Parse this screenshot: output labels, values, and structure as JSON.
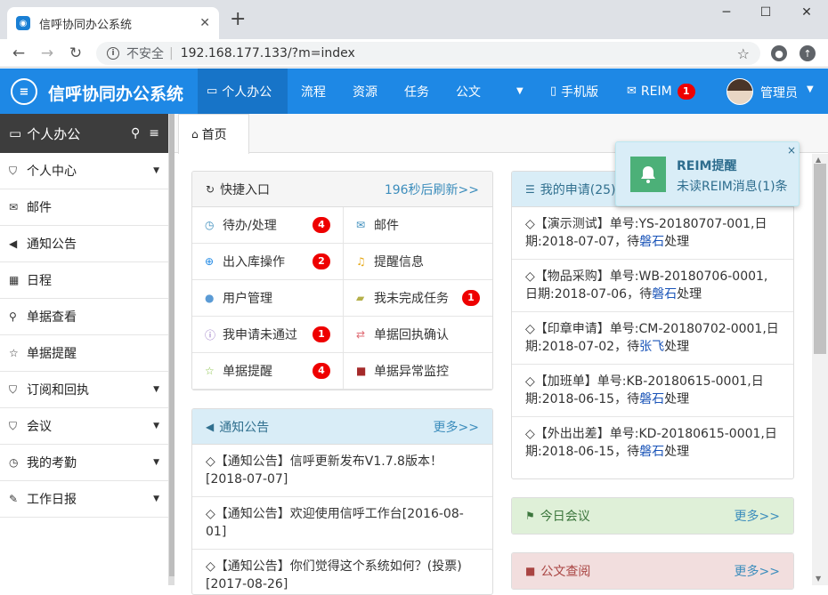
{
  "browser": {
    "tab_title": "信呼协同办公系统",
    "tab_close": "✕",
    "new_tab": "+",
    "insecure_label": "不安全",
    "url": "192.168.177.133/?m=index"
  },
  "nav": {
    "brand": "信呼协同办公系统",
    "items": [
      {
        "label": "个人办公",
        "active": true
      },
      {
        "label": "流程"
      },
      {
        "label": "资源"
      },
      {
        "label": "任务"
      },
      {
        "label": "公文"
      }
    ],
    "mobile": "手机版",
    "reim": "REIM",
    "reim_count": "1",
    "user": "管理员"
  },
  "sidebar": {
    "title": "个人办公",
    "items": [
      {
        "label": "个人中心",
        "icon": "bookmark-icon",
        "expandable": true
      },
      {
        "label": "邮件",
        "icon": "envelope-icon"
      },
      {
        "label": "通知公告",
        "icon": "volume-icon"
      },
      {
        "label": "日程",
        "icon": "calendar-icon"
      },
      {
        "label": "单据查看",
        "icon": "search-icon"
      },
      {
        "label": "单据提醒",
        "icon": "star-icon"
      },
      {
        "label": "订阅和回执",
        "icon": "bookmark-icon",
        "expandable": true
      },
      {
        "label": "会议",
        "icon": "bookmark-icon",
        "expandable": true
      },
      {
        "label": "我的考勤",
        "icon": "clock-icon",
        "expandable": true
      },
      {
        "label": "工作日报",
        "icon": "edit-icon",
        "expandable": true
      }
    ]
  },
  "tabs": {
    "home": "首页"
  },
  "quick": {
    "title": "快捷入口",
    "refresh": "196秒后刷新>>",
    "items": [
      {
        "label": "待办/处理",
        "badge": "4",
        "icon": "clock-icon",
        "color": "#3c8dbc"
      },
      {
        "label": "邮件",
        "badge": "",
        "icon": "envelope-icon",
        "color": "#3c8dbc"
      },
      {
        "label": "出入库操作",
        "badge": "2",
        "icon": "plus-circle-icon",
        "color": "#1e88e5"
      },
      {
        "label": "提醒信息",
        "badge": "",
        "icon": "bell-icon",
        "color": "#e6a817"
      },
      {
        "label": "用户管理",
        "badge": "",
        "icon": "user-icon",
        "color": "#5b9bd5"
      },
      {
        "label": "我未完成任务",
        "badge": "1",
        "icon": "book-icon",
        "color": "#b5b04a"
      },
      {
        "label": "我申请未通过",
        "badge": "1",
        "icon": "info-circle-icon",
        "color": "#8e6bbf"
      },
      {
        "label": "单据回执确认",
        "badge": "",
        "icon": "exchange-icon",
        "color": "#e06c75"
      },
      {
        "label": "单据提醒",
        "badge": "4",
        "icon": "star-icon",
        "color": "#8bc34a"
      },
      {
        "label": "单据异常监控",
        "badge": "",
        "icon": "briefcase-icon",
        "color": "#a52a2a"
      }
    ]
  },
  "notice": {
    "title": "通知公告",
    "more": "更多>>",
    "items": [
      "◇【通知公告】信呼更新发布V1.7.8版本！[2018-07-07]",
      "◇【通知公告】欢迎使用信呼工作台[2016-08-01]",
      "◇【通知公告】你们觉得这个系统如何？(投票)[2017-08-26]"
    ]
  },
  "apply": {
    "title": "我的申请(25)",
    "items": [
      {
        "text": "◇【演示测试】单号:YS-20180707-001,日期:2018-07-07，待",
        "person": "磐石",
        "suffix": "处理"
      },
      {
        "text": "◇【物品采购】单号:WB-20180706-0001,日期:2018-07-06，待",
        "person": "磐石",
        "suffix": "处理"
      },
      {
        "text": "◇【印章申请】单号:CM-20180702-0001,日期:2018-07-02，待",
        "person": "张飞",
        "suffix": "处理"
      },
      {
        "text": "◇【加班单】单号:KB-20180615-0001,日期:2018-06-15，待",
        "person": "磐石",
        "suffix": "处理"
      },
      {
        "text": "◇【外出出差】单号:KD-20180615-0001,日期:2018-06-15，待",
        "person": "磐石",
        "suffix": "处理"
      }
    ]
  },
  "meeting": {
    "title": "今日会议",
    "more": "更多>>"
  },
  "docs": {
    "title": "公文查阅",
    "more": "更多>>"
  },
  "toast": {
    "title": "REIM提醒",
    "message": "未读REIM消息(1)条",
    "close": "×"
  }
}
